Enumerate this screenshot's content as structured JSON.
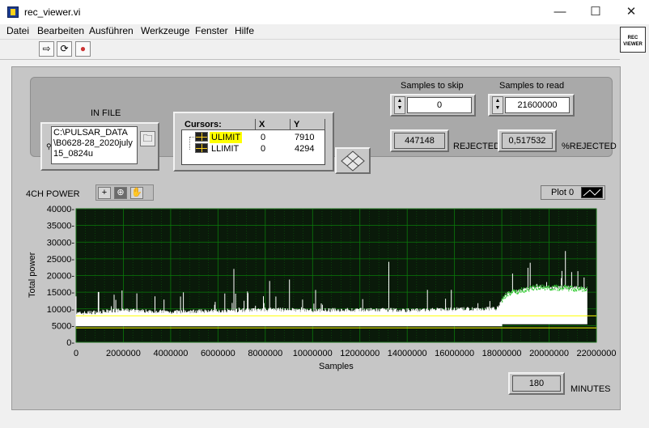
{
  "window": {
    "title": "rec_viewer.vi",
    "minimize": "—",
    "maximize": "☐",
    "close": "✕"
  },
  "menu": [
    "Datei",
    "Bearbeiten",
    "Ausführen",
    "Werkzeuge",
    "Fenster",
    "Hilfe"
  ],
  "vi_icon_text": [
    "REC",
    "VIEWER"
  ],
  "toolbar": {
    "run_icon": "run-arrow-icon",
    "run_continuous_icon": "run-continuously-icon",
    "abort_icon": "abort-icon"
  },
  "in_file": {
    "label": "IN FILE",
    "path": "C:\\PULSAR_DATA\\B0628-28_2020july15_0824u",
    "browse_icon": "folder-icon"
  },
  "samples_to_skip": {
    "label": "Samples to skip",
    "value": "0"
  },
  "samples_to_read": {
    "label": "Samples to read",
    "value": "21600000"
  },
  "rejected": {
    "value": "447148",
    "label": "REJECTED"
  },
  "pct_rejected": {
    "value": "0,517532",
    "label": "%REJECTED"
  },
  "cursors": {
    "headers": [
      "Cursors:",
      "X",
      "Y"
    ],
    "rows": [
      {
        "name": "ULIMIT",
        "x": "0",
        "y": "7910",
        "highlight": "#ffff00"
      },
      {
        "name": "LLIMIT",
        "x": "0",
        "y": "4294"
      }
    ]
  },
  "graph": {
    "label": "4CH POWER",
    "legend": "Plot 0",
    "tools": [
      "cursor-tool-icon",
      "zoom-tool-icon",
      "pan-hand-icon"
    ]
  },
  "minutes": {
    "value": "180",
    "label": "MINUTES"
  },
  "colors": {
    "plot_bg": "#0a1a0a",
    "grid": "#0a7a0a",
    "trace": "#ffffff",
    "ulimit": "#ffff00",
    "llimit": "#ffff00"
  },
  "chart_data": {
    "type": "line",
    "xlabel": "Samples",
    "ylabel": "Total power",
    "xlim": [
      0,
      22000000
    ],
    "ylim": [
      0,
      40000
    ],
    "x_ticks": [
      "0",
      "2000000",
      "4000000",
      "6000000",
      "8000000",
      "10000000",
      "12000000",
      "14000000",
      "16000000",
      "18000000",
      "20000000",
      "22000000"
    ],
    "y_ticks": [
      "0-",
      "5000-",
      "10000-",
      "15000-",
      "20000-",
      "25000-",
      "30000-",
      "35000-",
      "40000-"
    ],
    "grid": true,
    "series": [
      {
        "x": [
          0,
          2000000,
          4000000,
          6000000,
          8000000,
          10000000,
          12000000,
          14000000,
          16000000,
          17800000,
          18200000,
          19500000,
          21600000
        ],
        "values": [
          8000,
          9000,
          8500,
          8800,
          9200,
          9000,
          9100,
          9000,
          9300,
          9500,
          14000,
          16000,
          15500
        ]
      }
    ],
    "cursor_lines": [
      {
        "name": "ULIMIT",
        "y": 7910
      },
      {
        "name": "LLIMIT",
        "y": 4294
      }
    ]
  }
}
